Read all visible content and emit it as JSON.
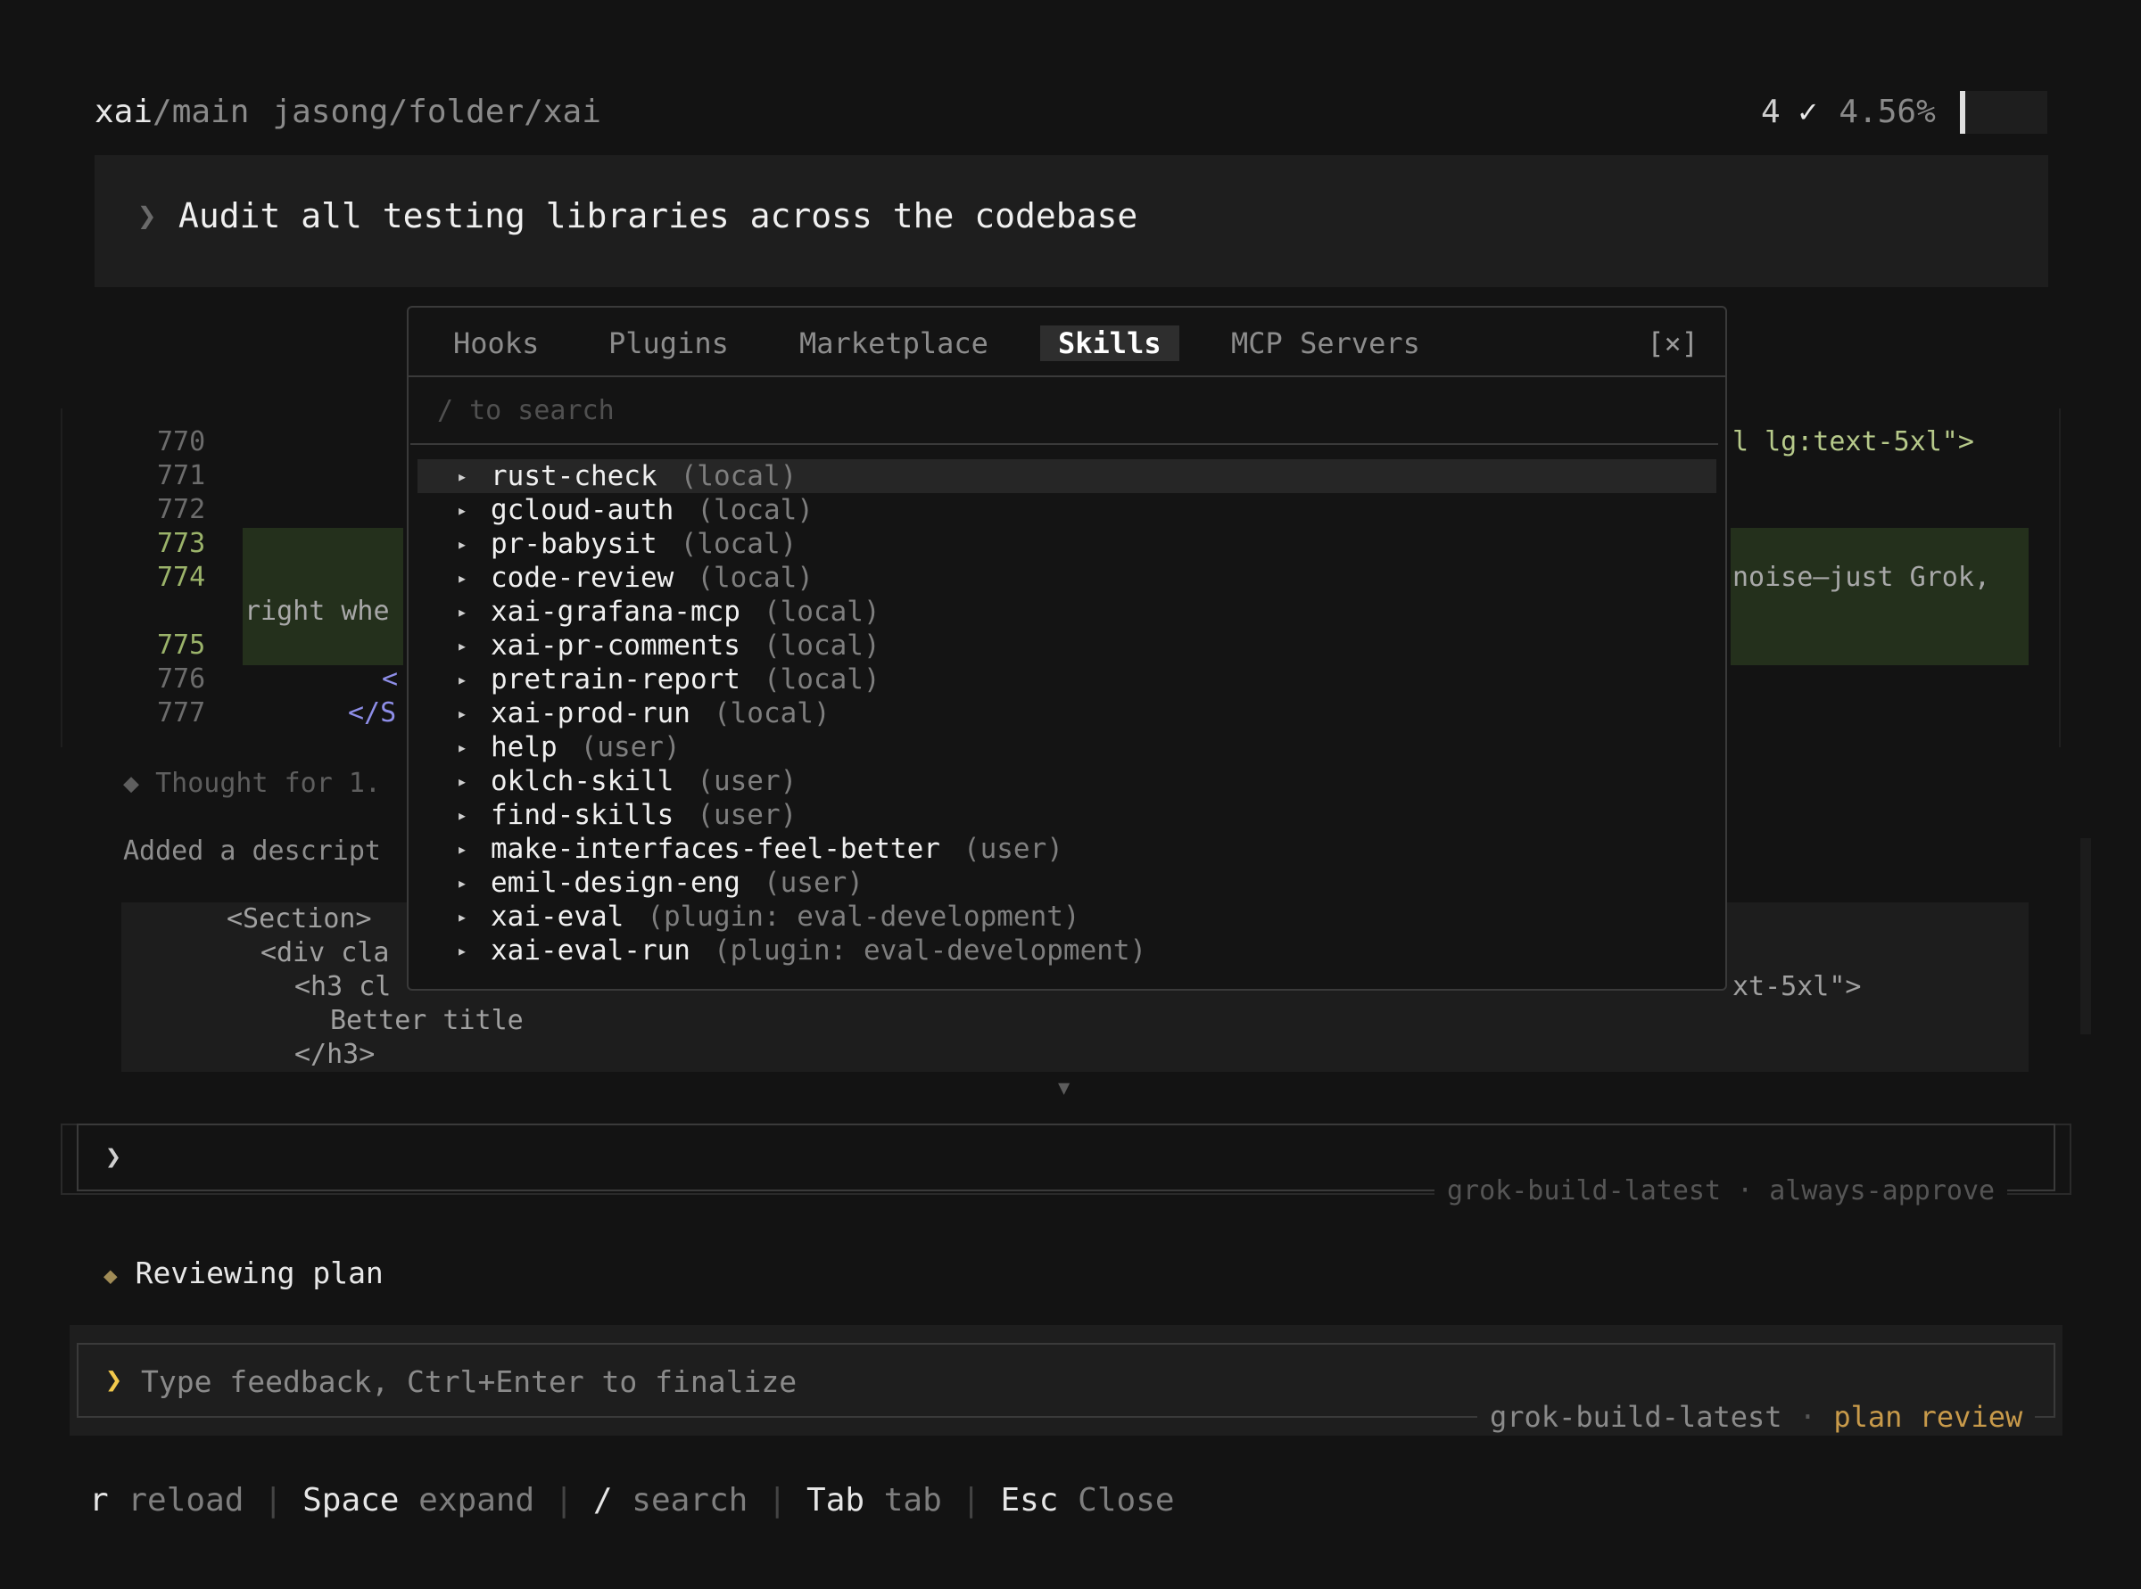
{
  "header": {
    "repo": "xai",
    "separator": "/",
    "branch": "main",
    "path": "jasong/folder/xai",
    "count": "4",
    "check": "✓",
    "percent": "4.56%"
  },
  "prompt": {
    "chevron": "❯",
    "text": "Audit all testing libraries across the codebase"
  },
  "code": {
    "line_numbers": [
      "770",
      "771",
      "772",
      "773",
      "774",
      "775",
      "776",
      "777"
    ],
    "line_770_right": "l lg:text-5xl\">",
    "line_774_right": "noise—just Grok,",
    "line_774b_left": "right whe",
    "line_776_left": "<",
    "line_777_left": "</S"
  },
  "thought": "◆ Thought for 1.",
  "added": "Added a descript",
  "snippet": {
    "l1": "<Section>",
    "l2": "<div cla",
    "l3": "<h3 cl",
    "l3_right": "xt-5xl\">",
    "l4": "Better title",
    "l5": "</h3>"
  },
  "modal": {
    "tabs": [
      "Hooks",
      "Plugins",
      "Marketplace",
      "Skills",
      "MCP Servers"
    ],
    "active_tab": "Skills",
    "close": "[×]",
    "search_placeholder": "/ to search",
    "skills": [
      {
        "name": "rust-check",
        "tag": "(local)"
      },
      {
        "name": "gcloud-auth",
        "tag": "(local)"
      },
      {
        "name": "pr-babysit",
        "tag": "(local)"
      },
      {
        "name": "code-review",
        "tag": "(local)"
      },
      {
        "name": "xai-grafana-mcp",
        "tag": "(local)"
      },
      {
        "name": "xai-pr-comments",
        "tag": "(local)"
      },
      {
        "name": "pretrain-report",
        "tag": "(local)"
      },
      {
        "name": "xai-prod-run",
        "tag": "(local)"
      },
      {
        "name": "help",
        "tag": "(user)"
      },
      {
        "name": "oklch-skill",
        "tag": "(user)"
      },
      {
        "name": "find-skills",
        "tag": "(user)"
      },
      {
        "name": "make-interfaces-feel-better",
        "tag": "(user)"
      },
      {
        "name": "emil-design-eng",
        "tag": "(user)"
      },
      {
        "name": "xai-eval",
        "tag": "(plugin: eval-development)"
      },
      {
        "name": "xai-eval-run",
        "tag": "(plugin: eval-development)"
      }
    ],
    "selected_index": 0,
    "expand_glyph": "▸"
  },
  "input1": {
    "chevron": "❯",
    "meta": "grok-build-latest · always-approve"
  },
  "reviewing": {
    "icon": "◆",
    "text": "Reviewing plan"
  },
  "feedback": {
    "chevron": "❯",
    "placeholder": "Type feedback, Ctrl+Enter to finalize",
    "model": "grok-build-latest",
    "dot": " · ",
    "mode": "plan review"
  },
  "footer": [
    {
      "key": "r",
      "action": "reload"
    },
    {
      "key": "Space",
      "action": "expand"
    },
    {
      "key": "/",
      "action": "search"
    },
    {
      "key": "Tab",
      "action": "tab"
    },
    {
      "key": "Esc",
      "action": "Close"
    }
  ],
  "colors": {
    "background": "#131313",
    "panel": "#1e1e1e",
    "accent_yellow": "#f2c94c",
    "accent_orange": "#c89a4a",
    "diff_green": "#24301c"
  }
}
